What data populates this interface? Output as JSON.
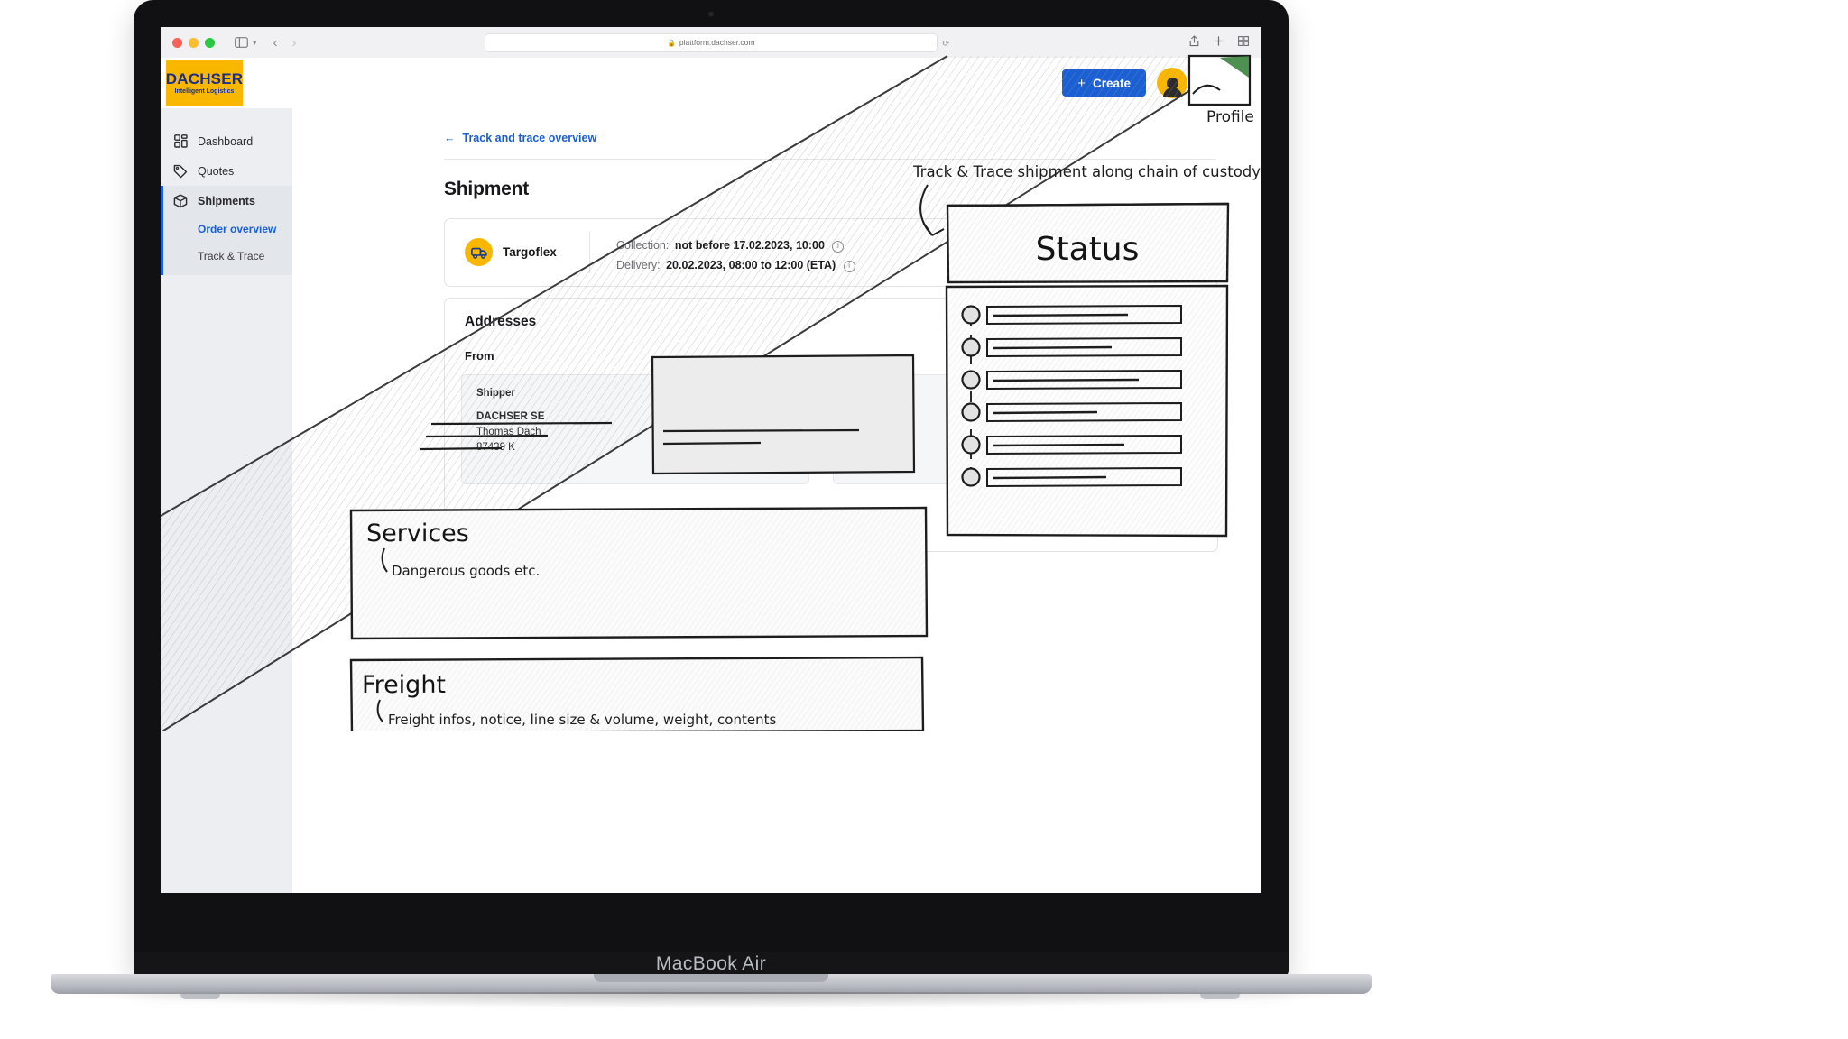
{
  "device": {
    "model_label": "MacBook Air"
  },
  "browser": {
    "url": "plattform.dachser.com",
    "lock_icon": "lock-icon",
    "reload_icon": "reload-icon",
    "sidebar_icon": "sidebar-toggle-icon",
    "back_icon": "back-arrow-icon",
    "forward_icon": "forward-arrow-icon",
    "reader_icon": "reader-view-icon",
    "share_icon": "share-icon",
    "newtab_icon": "new-tab-icon",
    "tabs_icon": "tab-overview-icon"
  },
  "header": {
    "logo_main": "DACHSER",
    "logo_sub": "Intelligent Logistics",
    "create_label": "Create",
    "create_plus": "+",
    "create_color": "#1a5fd4",
    "avatar_name": "avatar",
    "help_label": "?"
  },
  "sidebar": {
    "items": [
      {
        "label": "Dashboard",
        "icon": "grid-icon",
        "active": false
      },
      {
        "label": "Quotes",
        "icon": "tag-icon",
        "active": false
      },
      {
        "label": "Shipments",
        "icon": "box-icon",
        "active": true
      }
    ],
    "sub_items": [
      {
        "label": "Order overview",
        "active": true
      },
      {
        "label": "Track & Trace",
        "active": false
      }
    ],
    "accent_color": "#1a5fd4"
  },
  "main": {
    "back_link": "Track and trace overview",
    "back_arrow": "←",
    "page_title": "Shipment",
    "shipment_card": {
      "carrier": "Targoflex",
      "carrier_icon": "truck-icon",
      "carrier_badge_color": "#f9b700",
      "collection_label": "Collection:",
      "collection_value": "not before 17.02.2023, 10:00",
      "delivery_label": "Delivery:",
      "delivery_value": "20.02.2023, 08:00 to 12:00 (ETA)",
      "info_icon": "info-icon"
    },
    "addresses": {
      "title": "Addresses",
      "from_label": "From",
      "shipper": {
        "heading": "Shipper",
        "line1": "DACHSER SE",
        "line2": "Thomas Dach",
        "line3": "87439 K"
      }
    }
  },
  "sketch": {
    "status_panel_title": "Status",
    "caption": "Track & Trace shipment along chain of custody",
    "profile_label": "Profile",
    "services_title": "Services",
    "services_note": "Dangerous goods etc.",
    "freight_title": "Freight",
    "freight_note": "Freight infos, notice, line size & volume, weight, contents",
    "status_steps": 6
  }
}
